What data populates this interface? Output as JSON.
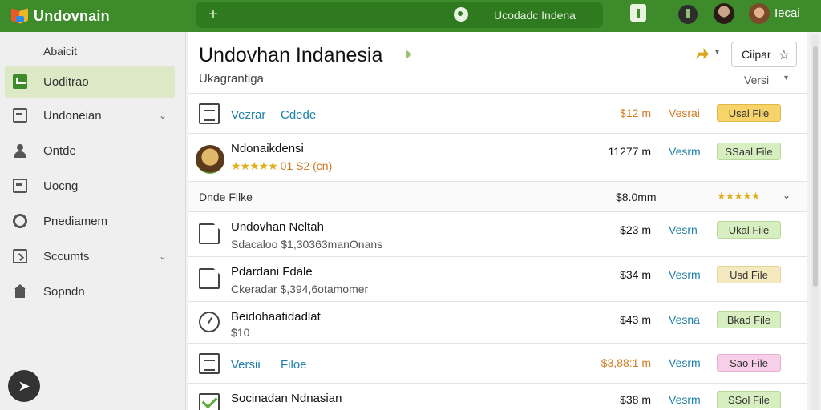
{
  "app": {
    "name": "Undovnain"
  },
  "search": {
    "text": "Ucodadc Indena"
  },
  "user": {
    "name": "Iecai"
  },
  "sidebar": {
    "header": "Abaicit",
    "items": [
      {
        "label": "Uoditrao",
        "icon": "check-square-icon"
      },
      {
        "label": "Undoneian",
        "icon": "inbox-icon"
      },
      {
        "label": "Ontde",
        "icon": "person-icon"
      },
      {
        "label": "Uocng",
        "icon": "box-icon"
      },
      {
        "label": "Pnediamem",
        "icon": "ring-icon"
      },
      {
        "label": "Sccumts",
        "icon": "stack-icon"
      },
      {
        "label": "Sopndn",
        "icon": "house-icon"
      }
    ]
  },
  "main": {
    "title": "Undovhan Indanesia",
    "subtitle": "Ukagrantiga",
    "top_button": "Ciipar",
    "version_label": "Versi",
    "rows": [
      {
        "link1": "Vezrar",
        "link2": "Cdede",
        "size": "$12 m",
        "version": "Vesrai",
        "chip": "Usal File"
      },
      {
        "name": "Ndonaikdensi",
        "rating": "★★★★★",
        "rating_text": "01 S2 (cn)",
        "size": "11277 m",
        "version": "Vesrm",
        "chip": "SSaal File"
      },
      {
        "name": "Undovhan Neltah",
        "meta": "Sdacaloo $1,30363manOnans",
        "size": "$23 m",
        "version": "Vesrn",
        "chip": "Ukal File"
      },
      {
        "name": "Pdardani Fdale",
        "meta": "Ckeradar $,394,6otamomer",
        "size": "$34 m",
        "version": "Vesrm",
        "chip": "Usd File"
      },
      {
        "name": "Beidohaatidadlat",
        "meta": "$10",
        "size": "$43 m",
        "version": "Vesna",
        "chip": "Bkad File"
      },
      {
        "link1": "Versii",
        "link2": "Filoe",
        "size": "$3,88:1 m",
        "version": "Vesrm",
        "chip": "Sao File"
      },
      {
        "name": "Socinadan Ndnasian",
        "size": "$38 m",
        "version": "Vesrm",
        "chip": "SSol File"
      }
    ],
    "group": {
      "label": "Dnde Filke",
      "size": "$8.0mm",
      "stars": "★★★★★"
    }
  }
}
